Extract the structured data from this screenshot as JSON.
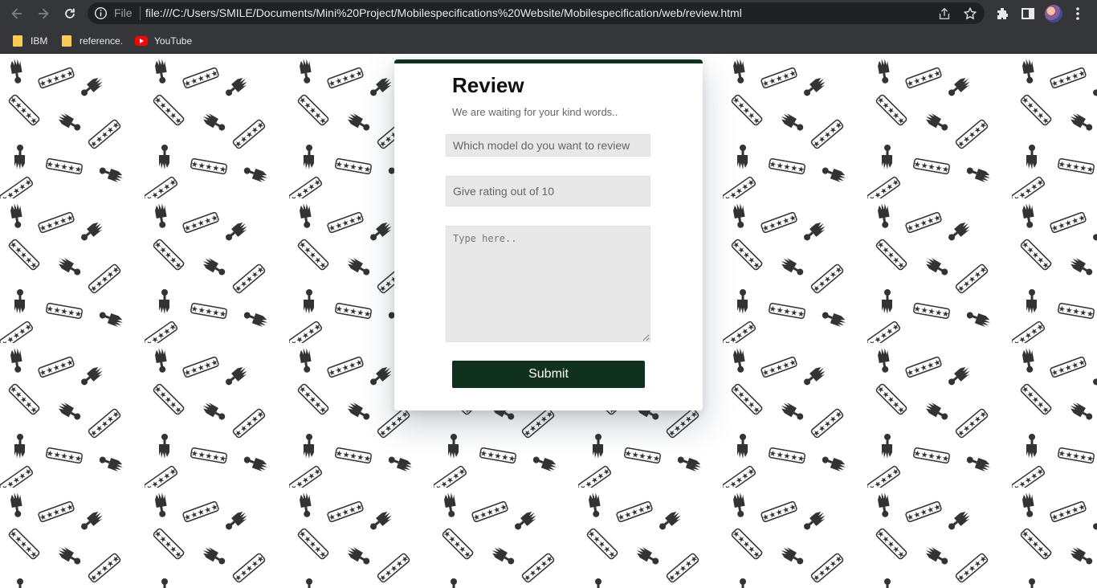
{
  "browser": {
    "scheme_label": "File",
    "url": "file:///C:/Users/SMILE/Documents/Mini%20Project/Mobilespecifications%20Website/Mobilespecification/web/review.html",
    "bookmarks": [
      {
        "label": "IBM",
        "icon": "folder-icon"
      },
      {
        "label": "reference.",
        "icon": "folder-icon"
      },
      {
        "label": "YouTube",
        "icon": "youtube-icon"
      }
    ],
    "theme_color": "#35363a"
  },
  "page": {
    "background_pattern": "hand-and-star-rating-icons",
    "accent_color": "#11311f",
    "review": {
      "title": "Review",
      "subtitle": "We are waiting for your kind words..",
      "model_placeholder": "Which model do you want to review",
      "rating_placeholder": "Give rating out of 10",
      "text_placeholder": "Type here..",
      "submit_label": "Submit"
    }
  }
}
